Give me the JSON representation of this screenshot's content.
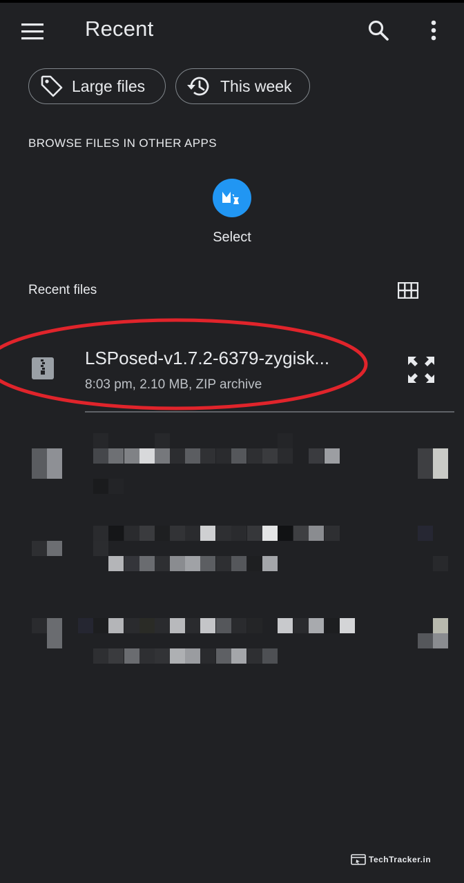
{
  "app_bar": {
    "title": "Recent",
    "menu_icon": "hamburger-menu-icon",
    "search_icon": "search-icon",
    "more_icon": "more-vert-icon"
  },
  "chips": [
    {
      "label": "Large files",
      "icon": "tag-icon"
    },
    {
      "label": "This week",
      "icon": "history-icon"
    }
  ],
  "browse_section": {
    "heading": "BROWSE FILES IN OTHER APPS",
    "apps": [
      {
        "label": "Select",
        "icon": "mixplorer-app-icon",
        "color": "#2196f3"
      }
    ]
  },
  "recent_files": {
    "heading": "Recent files",
    "view_toggle_icon": "grid-view-icon",
    "items": [
      {
        "name": "LSPosed-v1.7.2-6379-zygisk...",
        "meta": "8:03 pm, 2.10 MB, ZIP archive",
        "icon": "zip-file-icon",
        "action_icon": "expand-icon",
        "highlighted": true,
        "highlight_color": "#e0242b"
      },
      {
        "name": "",
        "meta": "",
        "pixelated": true
      },
      {
        "name": "",
        "meta": "",
        "pixelated": true
      },
      {
        "name": "",
        "meta": "",
        "pixelated": true
      }
    ]
  },
  "watermark": {
    "text": "TechTracker.in"
  },
  "colors": {
    "background": "#202124",
    "text_primary": "#e8eaed",
    "text_secondary": "#bdc1c6",
    "divider": "#5f6368",
    "accent_blue": "#2196f3"
  }
}
